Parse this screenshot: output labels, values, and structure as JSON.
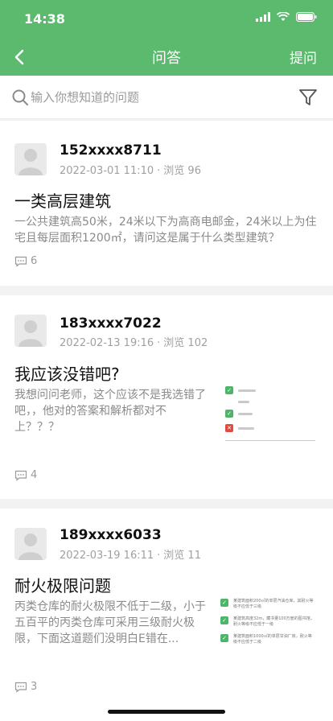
{
  "status_bar": {
    "time": "14:38"
  },
  "nav": {
    "title": "问答",
    "action_label": "提问"
  },
  "search": {
    "placeholder": "输入你想知道的问题"
  },
  "questions": [
    {
      "user": "152xxxx8711",
      "date": "2022-03-01 11:10",
      "views": "浏览 96",
      "title": "一类高层建筑",
      "body": "一公共建筑高50米，24米以下为高商电邮金，24米以上为住宅且每层面积1200㎡，请问这是属于什么类型建筑？",
      "comments": "6"
    },
    {
      "user": "183xxxx7022",
      "date": "2022-02-13 19:16",
      "views": "浏览 102",
      "title": "我应该没错吧?",
      "body": "我想问问老师，这个应该不是我选错了吧，，他对的答案和解析都对不上？？？",
      "comments": "4"
    },
    {
      "user": "189xxxx6033",
      "date": "2022-03-19 16:11",
      "views": "浏览 11",
      "title": "耐火极限问题",
      "body": "丙类仓库的耐火极限不低于二级，小于五百平的丙类仓库可采用三级耐火极限，下面这道题们没明白E错在...",
      "comments": "3",
      "thumb_lines": [
        "某建筑面积200㎡的单层汽油仓库，其耐火等级不应低于三级",
        "某建筑高度32m，藏书量100万册的图书馆，耐火等级不应低于一级",
        "某建筑面积1000㎡的单层甘油厂房，耐火等级不应低于二级"
      ]
    }
  ],
  "colors": {
    "accent": "#5cba6e",
    "muted": "#a0a0a0"
  }
}
